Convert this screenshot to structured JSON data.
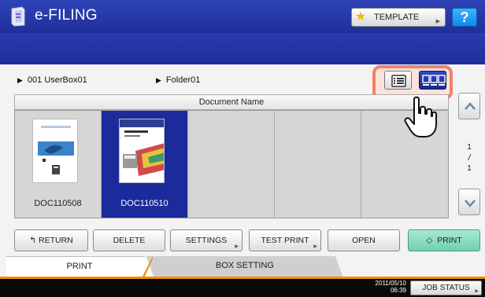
{
  "app": {
    "title": "e-FILING"
  },
  "titlebar": {
    "template_label": "TEMPLATE",
    "help_label": "?"
  },
  "breadcrumb": {
    "box": "001 UserBox01",
    "folder": "Folder01"
  },
  "table": {
    "column_header": "Document Name"
  },
  "documents": [
    {
      "name": "DOC110508"
    },
    {
      "name": "DOC110510"
    },
    {
      "name": ""
    },
    {
      "name": ""
    },
    {
      "name": ""
    }
  ],
  "pagination": {
    "current": "1",
    "total": "1"
  },
  "actions": {
    "return": "RETURN",
    "delete": "DELETE",
    "settings": "SETTINGS",
    "test_print": "TEST PRINT",
    "open": "OPEN",
    "print": "PRINT"
  },
  "tabs": {
    "print": "PRINT",
    "box_setting": "BOX SETTING"
  },
  "footer": {
    "date": "2011/05/10",
    "time": "06:39",
    "job_status": "JOB STATUS"
  },
  "colors": {
    "title_blue": "#1f2f9a",
    "selected": "#1c2b9c",
    "tab_accent": "#f28c00",
    "print_green": "#6fcfae",
    "highlight": "#f0826a"
  }
}
